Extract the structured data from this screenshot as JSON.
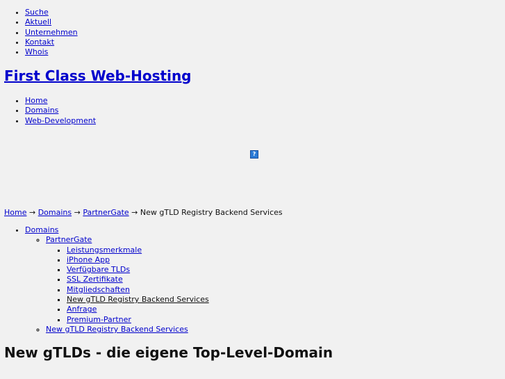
{
  "topnav": {
    "items": [
      "Suche",
      "Aktuell",
      "Unternehmen",
      "Kontakt",
      "Whois"
    ]
  },
  "site_title": "First Class Web-Hosting",
  "mainnav": {
    "items": [
      "Home",
      "Domains",
      "Web-Development"
    ]
  },
  "image_placeholder": "?",
  "breadcrumb": {
    "items": [
      "Home",
      "Domains",
      "PartnerGate"
    ],
    "separator": "→",
    "current": "New gTLD Registry Backend Services"
  },
  "subnav": {
    "root": "Domains",
    "partnergate": "PartnerGate",
    "children": [
      "Leistungsmerkmale",
      "iPhone App",
      "Verfügbare TLDs",
      "SSL Zertifikate",
      "Mitgliedschaften",
      "New gTLD Registry Backend Services",
      "Anfrage",
      "Premium-Partner"
    ],
    "sibling": "New gTLD Registry Backend Services"
  },
  "page_heading": "New gTLDs - die eigene Top-Level-Domain",
  "colors": {
    "background": "#f1f1f1",
    "link": "#0000cc",
    "text": "#111111"
  }
}
